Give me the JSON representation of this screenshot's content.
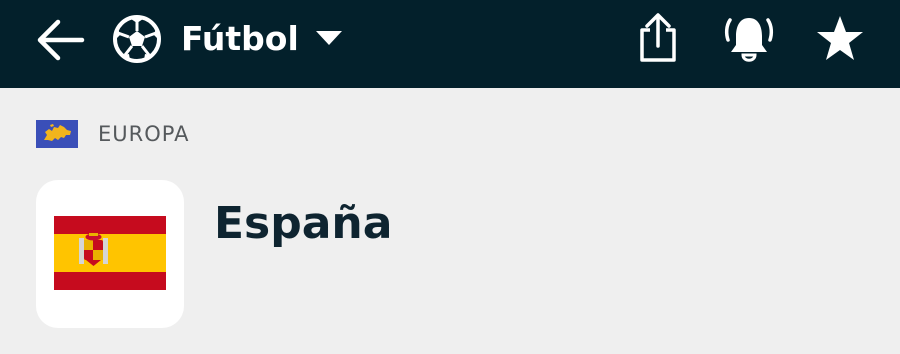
{
  "topbar": {
    "background_color": "#03202b",
    "icon_color": "#ffffff",
    "sport_label": "Fútbol",
    "icons": {
      "back": "back-arrow-icon",
      "sport": "soccer-ball-icon",
      "dropdown": "caret-down-icon",
      "share": "share-icon",
      "notifications": "bell-ringing-icon",
      "favorite": "star-icon"
    }
  },
  "region": {
    "label": "EUROPA",
    "flag_icon": "europe-flag-icon"
  },
  "country": {
    "name": "España",
    "flag_icon": "spain-flag-icon"
  }
}
